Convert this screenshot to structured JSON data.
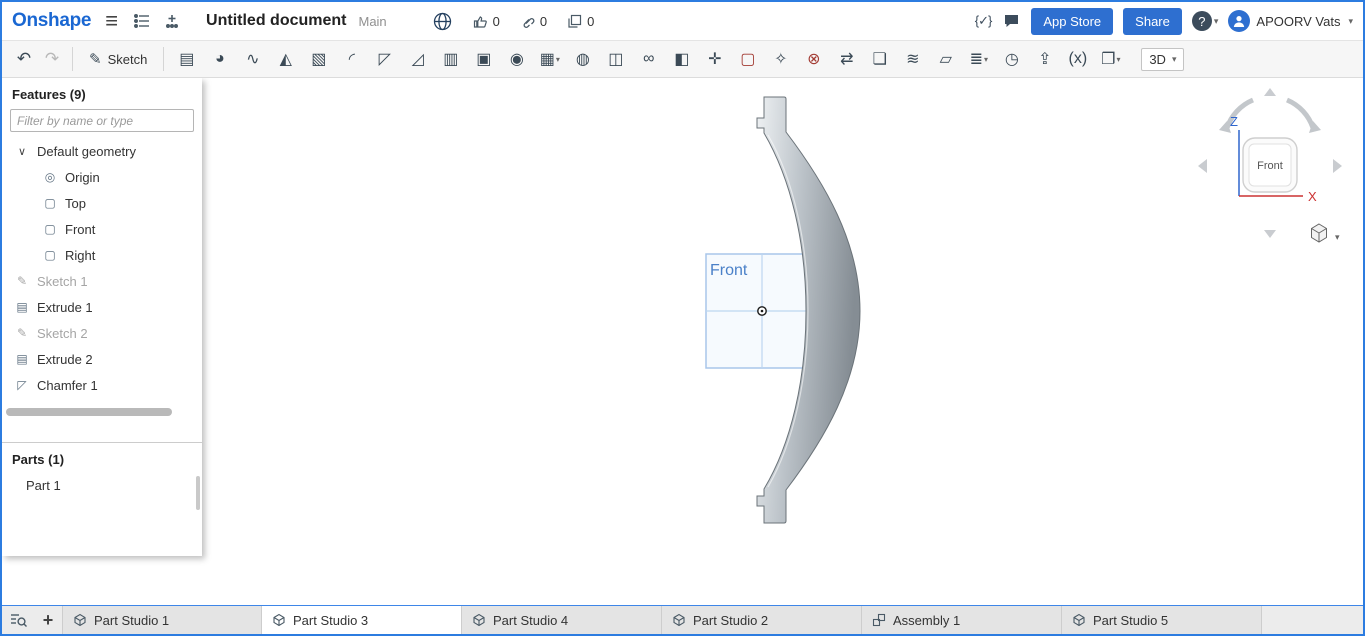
{
  "colors": {
    "brand_blue": "#1a67d2",
    "button_blue": "#2e6fd0",
    "window_border": "#2c7ce0",
    "axis_z_blue": "#2f66cc",
    "axis_x_red": "#cc3232",
    "plane_blue": "#a8c6ea",
    "part_gray_light": "#eef1f3",
    "part_gray_dark": "#858d94"
  },
  "glyphs": {
    "hamburger": "≡",
    "undo": "↶",
    "redo": "↷",
    "pencil": "✎",
    "featurescript": "{✓}",
    "help": "?",
    "caret": "▾",
    "plus": "+"
  },
  "header": {
    "logo_text": "Onshape",
    "document_title": "Untitled document",
    "workspace_label": "Main",
    "like_count": "0",
    "link_count": "0",
    "fork_count": "0",
    "app_store_button": "App Store",
    "share_button": "Share",
    "user_name": "APOORV Vats"
  },
  "toolbar": {
    "sketch_label": "Sketch",
    "view_3d_label": "3D",
    "tools": [
      {
        "name": "extrude-icon",
        "glyph": "▤"
      },
      {
        "name": "revolve-icon",
        "glyph": "◕"
      },
      {
        "name": "sweep-icon",
        "glyph": "∿"
      },
      {
        "name": "loft-icon",
        "glyph": "◭"
      },
      {
        "name": "thicken-icon",
        "glyph": "▧"
      },
      {
        "name": "fillet-icon",
        "glyph": "◜"
      },
      {
        "name": "chamfer-icon",
        "glyph": "◸"
      },
      {
        "name": "draft-icon",
        "glyph": "◿"
      },
      {
        "name": "rib-icon",
        "glyph": "▥"
      },
      {
        "name": "shell-icon",
        "glyph": "▣"
      },
      {
        "name": "hole-icon",
        "glyph": "◉"
      },
      {
        "name": "linear-pattern-icon",
        "glyph": "▦",
        "caret": true
      },
      {
        "name": "circular-pattern-icon",
        "glyph": "◍"
      },
      {
        "name": "mirror-icon",
        "glyph": "◫"
      },
      {
        "name": "boolean-icon",
        "glyph": "∞"
      },
      {
        "name": "split-icon",
        "glyph": "◧"
      },
      {
        "name": "transform-icon",
        "glyph": "✛"
      },
      {
        "name": "delete-part-icon",
        "glyph": "▢",
        "danger": true
      },
      {
        "name": "modify-fillet-icon",
        "glyph": "✧"
      },
      {
        "name": "delete-face-icon",
        "glyph": "⊗",
        "danger": true
      },
      {
        "name": "move-face-icon",
        "glyph": "⇄"
      },
      {
        "name": "replace-face-icon",
        "glyph": "❏"
      },
      {
        "name": "offset-surface-icon",
        "glyph": "≋"
      },
      {
        "name": "fill-surface-icon",
        "glyph": "▱"
      },
      {
        "name": "appearance-icon",
        "glyph": "≣",
        "caret": true
      },
      {
        "name": "helix-icon",
        "glyph": "◷"
      },
      {
        "name": "export-icon",
        "glyph": "⇪"
      },
      {
        "name": "variable-icon",
        "glyph": "(x)"
      },
      {
        "name": "sheet-metal-icon",
        "glyph": "❐",
        "caret": true
      }
    ]
  },
  "sidebar": {
    "features_title": "Features (9)",
    "filter_placeholder": "Filter by name or type",
    "tree": [
      {
        "label": "Default geometry",
        "icon": "chevron-down-icon",
        "glyph": "∨"
      },
      {
        "label": "Origin",
        "icon": "origin-icon",
        "glyph": "◎"
      },
      {
        "label": "Top",
        "icon": "plane-icon",
        "glyph": "▢"
      },
      {
        "label": "Front",
        "icon": "plane-icon",
        "glyph": "▢"
      },
      {
        "label": "Right",
        "icon": "plane-icon",
        "glyph": "▢"
      },
      {
        "label": "Sketch 1",
        "icon": "sketch-icon",
        "glyph": "✎",
        "muted": true
      },
      {
        "label": "Extrude 1",
        "icon": "extrude-icon",
        "glyph": "▤"
      },
      {
        "label": "Sketch 2",
        "icon": "sketch-icon",
        "glyph": "✎",
        "muted": true
      },
      {
        "label": "Extrude 2",
        "icon": "extrude-icon",
        "glyph": "▤"
      },
      {
        "label": "Chamfer 1",
        "icon": "chamfer-icon",
        "glyph": "◸"
      }
    ],
    "parts_title": "Parts (1)",
    "parts": [
      {
        "label": "Part 1"
      }
    ]
  },
  "canvas": {
    "plane_label": "Front",
    "view_cube": {
      "front_face": "Front",
      "z_axis": "Z",
      "x_axis": "X"
    }
  },
  "tab_bar": {
    "tabs": [
      {
        "label": "Part Studio 1",
        "type": "part-studio",
        "active": false
      },
      {
        "label": "Part Studio 3",
        "type": "part-studio",
        "active": true
      },
      {
        "label": "Part Studio 4",
        "type": "part-studio",
        "active": false
      },
      {
        "label": "Part Studio 2",
        "type": "part-studio",
        "active": false
      },
      {
        "label": "Assembly 1",
        "type": "assembly",
        "active": false
      },
      {
        "label": "Part Studio 5",
        "type": "part-studio",
        "active": false
      }
    ]
  }
}
